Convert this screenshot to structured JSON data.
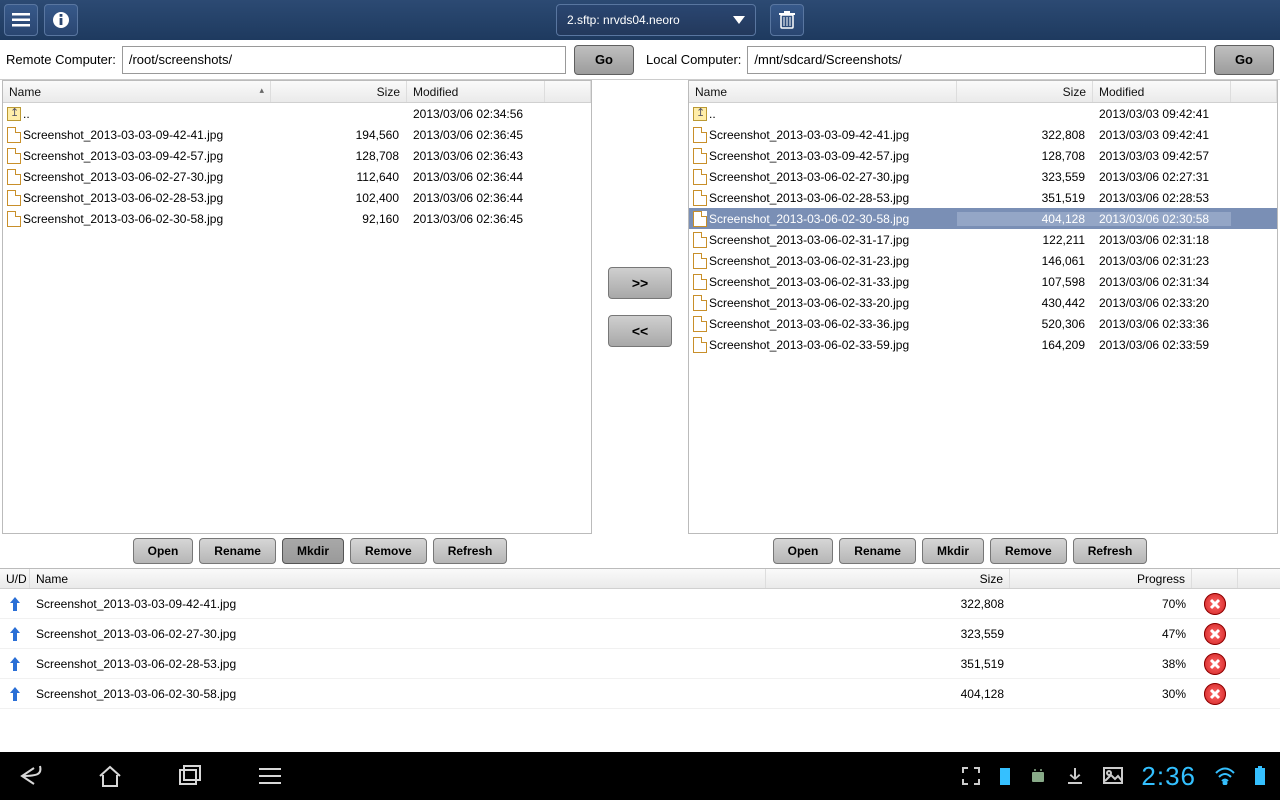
{
  "topbar": {
    "connection_label": "2.sftp: nrvds04.neoro"
  },
  "remote": {
    "label": "Remote Computer:",
    "path": "/root/screenshots/",
    "go": "Go",
    "columns": {
      "name": "Name",
      "size": "Size",
      "modified": "Modified"
    },
    "up_label": "..",
    "rows": [
      {
        "name": "Screenshot_2013-03-03-09-42-41.jpg",
        "size": "194,560",
        "modified": "2013/03/06 02:36:45"
      },
      {
        "name": "Screenshot_2013-03-03-09-42-57.jpg",
        "size": "128,708",
        "modified": "2013/03/06 02:36:43"
      },
      {
        "name": "Screenshot_2013-03-06-02-27-30.jpg",
        "size": "112,640",
        "modified": "2013/03/06 02:36:44"
      },
      {
        "name": "Screenshot_2013-03-06-02-28-53.jpg",
        "size": "102,400",
        "modified": "2013/03/06 02:36:44"
      },
      {
        "name": "Screenshot_2013-03-06-02-30-58.jpg",
        "size": "92,160",
        "modified": "2013/03/06 02:36:45"
      }
    ],
    "up_modified": "2013/03/06 02:34:56"
  },
  "local": {
    "label": "Local Computer:",
    "path": "/mnt/sdcard/Screenshots/",
    "go": "Go",
    "columns": {
      "name": "Name",
      "size": "Size",
      "modified": "Modified"
    },
    "up_label": "..",
    "up_modified": "2013/03/03 09:42:41",
    "selected_index": 4,
    "rows": [
      {
        "name": "Screenshot_2013-03-03-09-42-41.jpg",
        "size": "322,808",
        "modified": "2013/03/03 09:42:41"
      },
      {
        "name": "Screenshot_2013-03-03-09-42-57.jpg",
        "size": "128,708",
        "modified": "2013/03/03 09:42:57"
      },
      {
        "name": "Screenshot_2013-03-06-02-27-30.jpg",
        "size": "323,559",
        "modified": "2013/03/06 02:27:31"
      },
      {
        "name": "Screenshot_2013-03-06-02-28-53.jpg",
        "size": "351,519",
        "modified": "2013/03/06 02:28:53"
      },
      {
        "name": "Screenshot_2013-03-06-02-30-58.jpg",
        "size": "404,128",
        "modified": "2013/03/06 02:30:58"
      },
      {
        "name": "Screenshot_2013-03-06-02-31-17.jpg",
        "size": "122,211",
        "modified": "2013/03/06 02:31:18"
      },
      {
        "name": "Screenshot_2013-03-06-02-31-23.jpg",
        "size": "146,061",
        "modified": "2013/03/06 02:31:23"
      },
      {
        "name": "Screenshot_2013-03-06-02-31-33.jpg",
        "size": "107,598",
        "modified": "2013/03/06 02:31:34"
      },
      {
        "name": "Screenshot_2013-03-06-02-33-20.jpg",
        "size": "430,442",
        "modified": "2013/03/06 02:33:20"
      },
      {
        "name": "Screenshot_2013-03-06-02-33-36.jpg",
        "size": "520,306",
        "modified": "2013/03/06 02:33:36"
      },
      {
        "name": "Screenshot_2013-03-06-02-33-59.jpg",
        "size": "164,209",
        "modified": "2013/03/06 02:33:59"
      }
    ]
  },
  "transfer_buttons": {
    "to_remote": ">>",
    "to_local": "<<"
  },
  "actions": {
    "open": "Open",
    "rename": "Rename",
    "mkdir": "Mkdir",
    "remove": "Remove",
    "refresh": "Refresh"
  },
  "queue": {
    "columns": {
      "ud": "U/D",
      "name": "Name",
      "size": "Size",
      "progress": "Progress"
    },
    "rows": [
      {
        "dir": "up",
        "name": "Screenshot_2013-03-03-09-42-41.jpg",
        "size": "322,808",
        "progress": "70%"
      },
      {
        "dir": "up",
        "name": "Screenshot_2013-03-06-02-27-30.jpg",
        "size": "323,559",
        "progress": "47%"
      },
      {
        "dir": "up",
        "name": "Screenshot_2013-03-06-02-28-53.jpg",
        "size": "351,519",
        "progress": "38%"
      },
      {
        "dir": "up",
        "name": "Screenshot_2013-03-06-02-30-58.jpg",
        "size": "404,128",
        "progress": "30%"
      }
    ]
  },
  "navbar": {
    "clock": "2:36"
  }
}
